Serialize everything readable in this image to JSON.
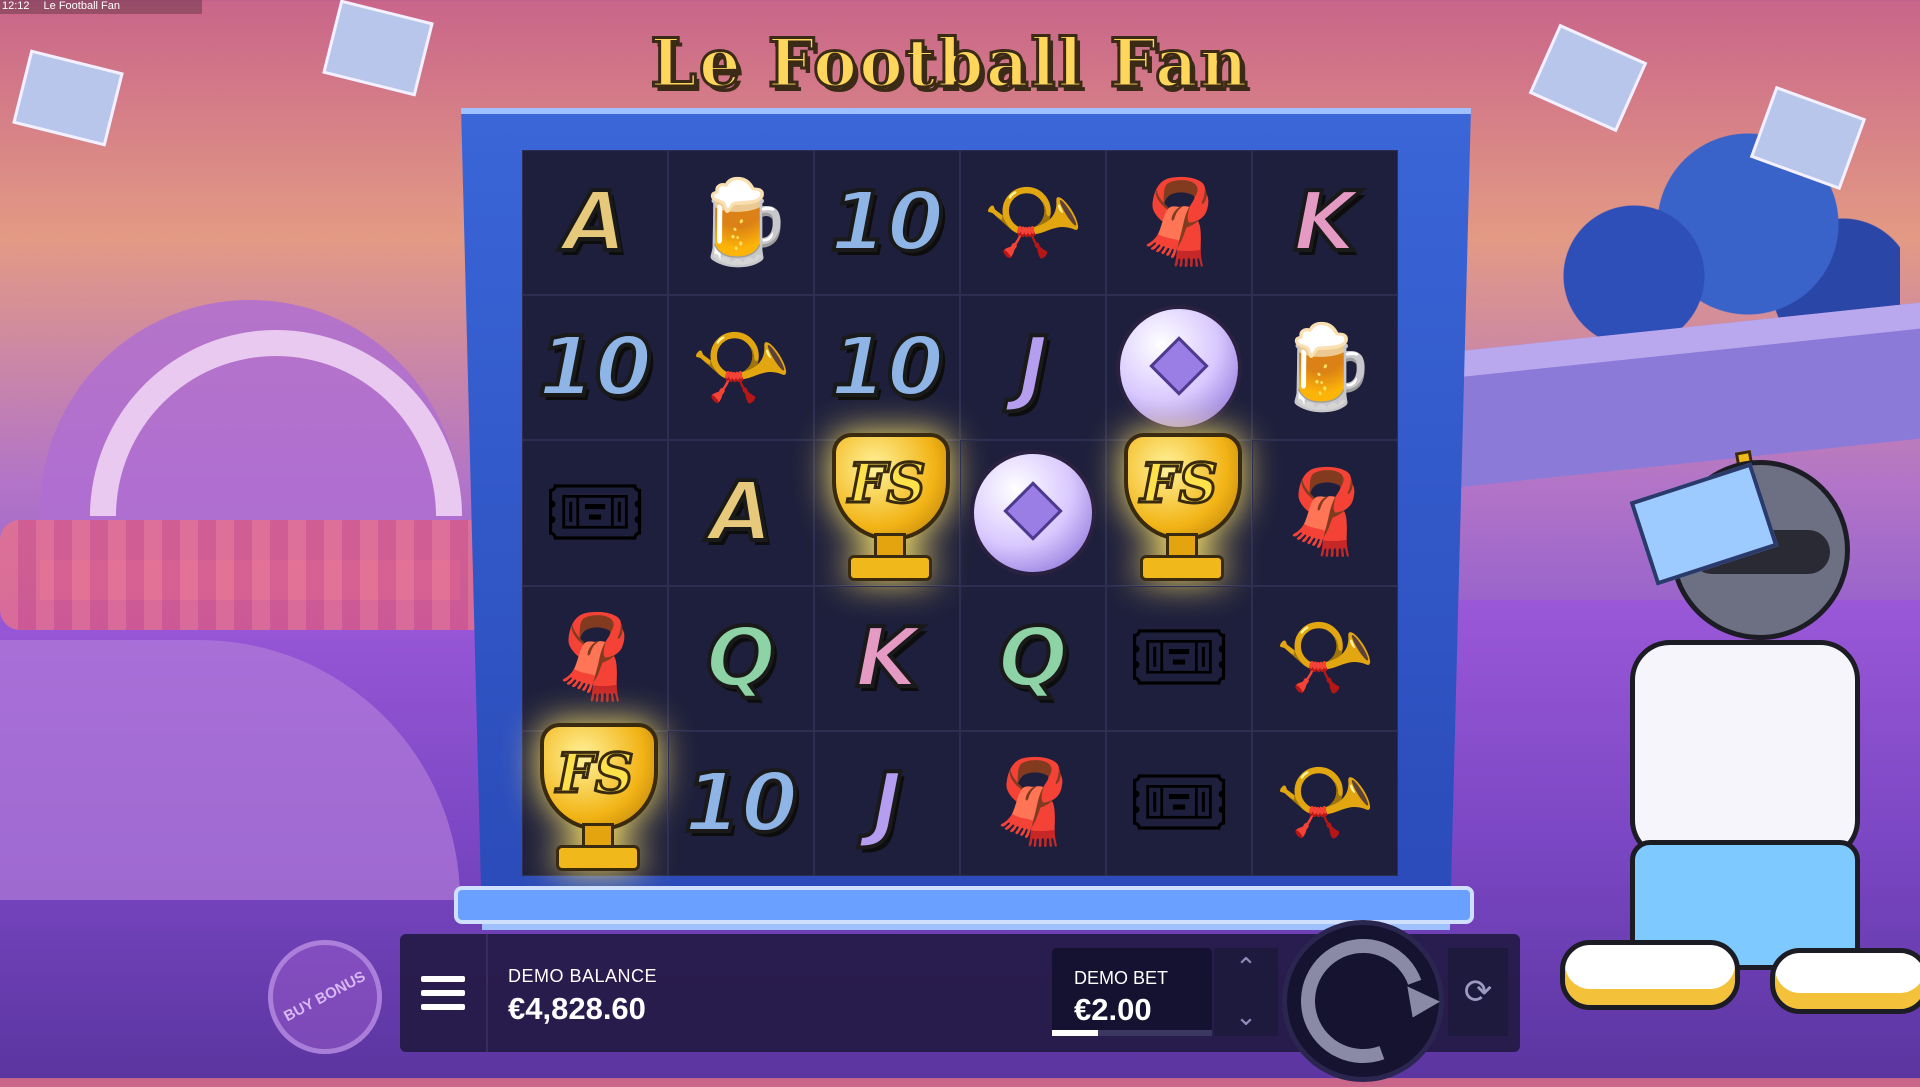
{
  "top_strip": {
    "time": "12:12",
    "title": "Le Football Fan"
  },
  "logo": {
    "text": "Le Football Fan"
  },
  "reels": {
    "rows": [
      [
        {
          "type": "letter",
          "label": "A",
          "color": "#e6c97a"
        },
        {
          "type": "icon",
          "name": "beer-mug-icon",
          "glyph": "🍺"
        },
        {
          "type": "letter",
          "label": "10",
          "color": "#8fb4e6"
        },
        {
          "type": "icon",
          "name": "horn-icon",
          "glyph": "📯"
        },
        {
          "type": "icon",
          "name": "scarf-icon",
          "glyph": "🧣"
        },
        {
          "type": "letter",
          "label": "K",
          "color": "#e59ac4"
        }
      ],
      [
        {
          "type": "letter",
          "label": "10",
          "color": "#8fb4e6"
        },
        {
          "type": "icon",
          "name": "horn-icon",
          "glyph": "📯"
        },
        {
          "type": "letter",
          "label": "10",
          "color": "#8fb4e6"
        },
        {
          "type": "letter",
          "label": "J",
          "color": "#b59ef0"
        },
        {
          "type": "ball"
        },
        {
          "type": "icon",
          "name": "beer-mug-icon",
          "glyph": "🍺"
        }
      ],
      [
        {
          "type": "icon",
          "name": "ticket-icon",
          "glyph": "🎟"
        },
        {
          "type": "letter",
          "label": "A",
          "color": "#e6c97a"
        },
        {
          "type": "fs",
          "label": "FS"
        },
        {
          "type": "ball"
        },
        {
          "type": "fs",
          "label": "FS"
        },
        {
          "type": "icon",
          "name": "scarf-icon",
          "glyph": "🧣"
        }
      ],
      [
        {
          "type": "icon",
          "name": "scarf-icon",
          "glyph": "🧣"
        },
        {
          "type": "letter",
          "label": "Q",
          "color": "#8dd3a6"
        },
        {
          "type": "letter",
          "label": "K",
          "color": "#e59ac4"
        },
        {
          "type": "letter",
          "label": "Q",
          "color": "#8dd3a6"
        },
        {
          "type": "icon",
          "name": "ticket-icon",
          "glyph": "🎟"
        },
        {
          "type": "icon",
          "name": "horn-icon",
          "glyph": "📯"
        }
      ],
      [
        {
          "type": "fs",
          "label": "FS"
        },
        {
          "type": "letter",
          "label": "10",
          "color": "#8fb4e6"
        },
        {
          "type": "letter",
          "label": "J",
          "color": "#b59ef0"
        },
        {
          "type": "icon",
          "name": "scarf-icon",
          "glyph": "🧣"
        },
        {
          "type": "icon",
          "name": "ticket-icon",
          "glyph": "🎟"
        },
        {
          "type": "icon",
          "name": "horn-icon",
          "glyph": "📯"
        }
      ]
    ]
  },
  "buy_bonus": {
    "label": "BUY BONUS"
  },
  "balance": {
    "label": "DEMO BALANCE",
    "value": "€4,828.60"
  },
  "bet": {
    "label": "DEMO BET",
    "value": "€2.00",
    "up_glyph": "⌃",
    "down_glyph": "⌄"
  },
  "autoplay": {
    "glyph": "⟳"
  },
  "colors": {
    "accent": "#ffd65c",
    "panel": "#201840"
  }
}
